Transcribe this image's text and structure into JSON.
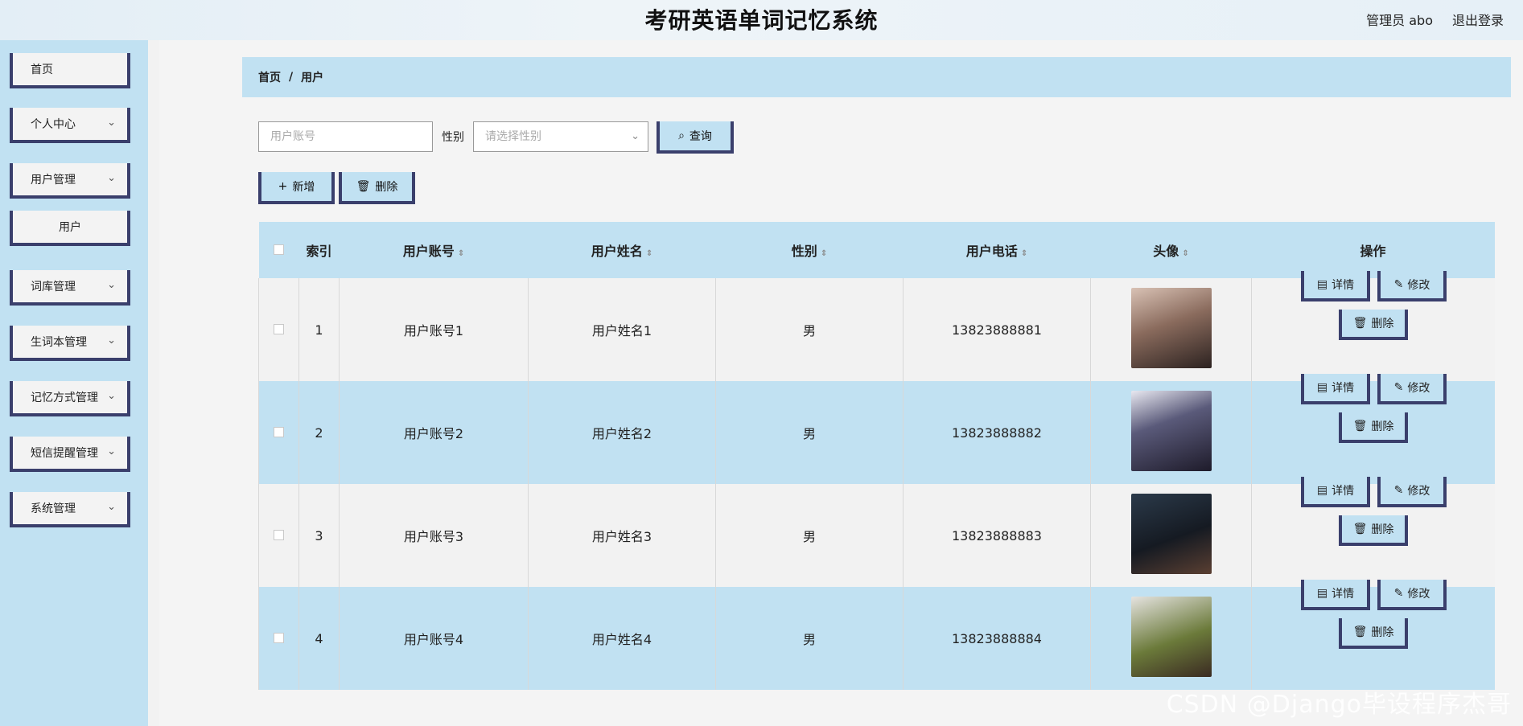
{
  "header": {
    "title": "考研英语单词记忆系统",
    "admin": "管理员 abo",
    "logout": "退出登录"
  },
  "sidebar": {
    "items": [
      {
        "label": "首页"
      },
      {
        "label": "个人中心"
      },
      {
        "label": "用户管理"
      },
      {
        "label": "用户"
      },
      {
        "label": "词库管理"
      },
      {
        "label": "生词本管理"
      },
      {
        "label": "记忆方式管理"
      },
      {
        "label": "短信提醒管理"
      },
      {
        "label": "系统管理"
      }
    ]
  },
  "breadcrumb": {
    "home": "首页",
    "sep": "/",
    "current": "用户"
  },
  "search": {
    "account_placeholder": "用户账号",
    "gender_label": "性别",
    "gender_placeholder": "请选择性别",
    "query": "查询"
  },
  "actions": {
    "add": "新增",
    "delete": "删除"
  },
  "table": {
    "headers": [
      "索引",
      "用户账号",
      "用户姓名",
      "性别",
      "用户电话",
      "头像",
      "操作"
    ],
    "rows": [
      {
        "index": "1",
        "account": "用户账号1",
        "name": "用户姓名1",
        "gender": "男",
        "phone": "13823888881"
      },
      {
        "index": "2",
        "account": "用户账号2",
        "name": "用户姓名2",
        "gender": "男",
        "phone": "13823888882"
      },
      {
        "index": "3",
        "account": "用户账号3",
        "name": "用户姓名3",
        "gender": "男",
        "phone": "13823888883"
      },
      {
        "index": "4",
        "account": "用户账号4",
        "name": "用户姓名4",
        "gender": "男",
        "phone": "13823888884"
      }
    ],
    "ops": {
      "detail": "详情",
      "edit": "修改",
      "delete": "删除"
    }
  },
  "watermark": "CSDN @Django毕设程序杰哥",
  "colors": {
    "accent": "#c1e1f2",
    "border": "#3a3f6c"
  }
}
